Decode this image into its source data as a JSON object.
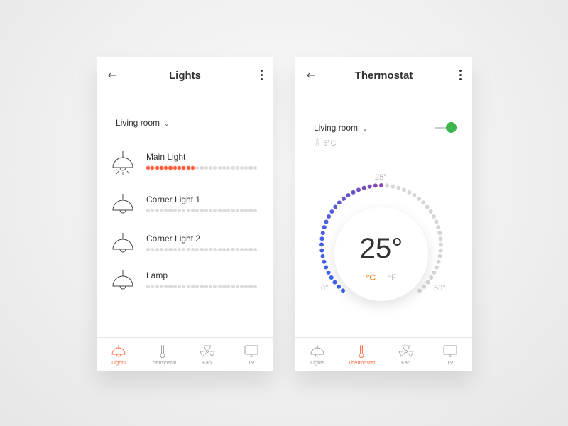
{
  "lights_screen": {
    "title": "Lights",
    "room": "Living room",
    "items": [
      {
        "name": "Main Light",
        "level": 11,
        "total": 25,
        "on": true
      },
      {
        "name": "Corner Light 1",
        "level": 0,
        "total": 25,
        "on": false
      },
      {
        "name": "Corner Light 2",
        "level": 0,
        "total": 25,
        "on": false
      },
      {
        "name": "Lamp",
        "level": 0,
        "total": 25,
        "on": false
      }
    ],
    "nav": [
      {
        "label": "Lights",
        "icon": "lamp-icon",
        "active": true
      },
      {
        "label": "Thermostat",
        "icon": "thermometer-icon",
        "active": false
      },
      {
        "label": "Fan",
        "icon": "fan-icon",
        "active": false
      },
      {
        "label": "TV",
        "icon": "tv-icon",
        "active": false
      }
    ]
  },
  "thermostat_screen": {
    "title": "Thermostat",
    "room": "Living room",
    "power_on": true,
    "outside_temp": "5°C",
    "set_temp": "25°",
    "set_value": 25,
    "min_label": "0°",
    "max_label": "50°",
    "top_label": "25°",
    "unit_c": "°C",
    "unit_f": "°F",
    "active_unit": "C",
    "nav": [
      {
        "label": "Lights",
        "icon": "lamp-icon",
        "active": false
      },
      {
        "label": "Thermostat",
        "icon": "thermometer-icon",
        "active": true
      },
      {
        "label": "Fan",
        "icon": "fan-icon",
        "active": false
      },
      {
        "label": "TV",
        "icon": "tv-icon",
        "active": false
      }
    ]
  },
  "colors": {
    "accent": "#ff5a36",
    "toggle_on": "#3cb54a",
    "arc_start": "#3d63f0",
    "arc_end": "#8a48b0",
    "inactive": "#d6d6d6"
  }
}
